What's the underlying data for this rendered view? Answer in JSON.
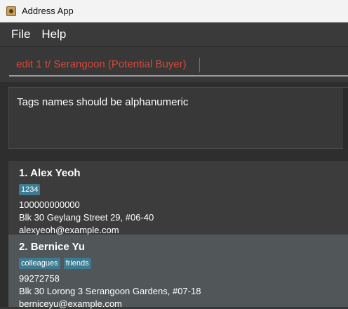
{
  "window": {
    "title": "Address App",
    "icon": "address-book-icon"
  },
  "menu": {
    "items": [
      "File",
      "Help"
    ]
  },
  "command": {
    "value": "edit 1 t/ Serangoon (Potential Buyer)"
  },
  "result": {
    "message": "Tags names should be alphanumeric"
  },
  "persons": [
    {
      "index": "1.",
      "name": "Alex Yeoh",
      "tags": [
        "1234"
      ],
      "phone": "100000000000",
      "address": "Blk 30 Geylang Street 29, #06-40",
      "email": "alexyeoh@example.com"
    },
    {
      "index": "2.",
      "name": "Bernice Yu",
      "tags": [
        "colleagues",
        "friends"
      ],
      "phone": "99272758",
      "address": "Blk 30 Lorong 3 Serangoon Gardens, #07-18",
      "email": "berniceyu@example.com"
    }
  ],
  "colors": {
    "command_text": "#d24a3c",
    "tag_background": "#3e7b91",
    "selected_card": "#515658"
  }
}
